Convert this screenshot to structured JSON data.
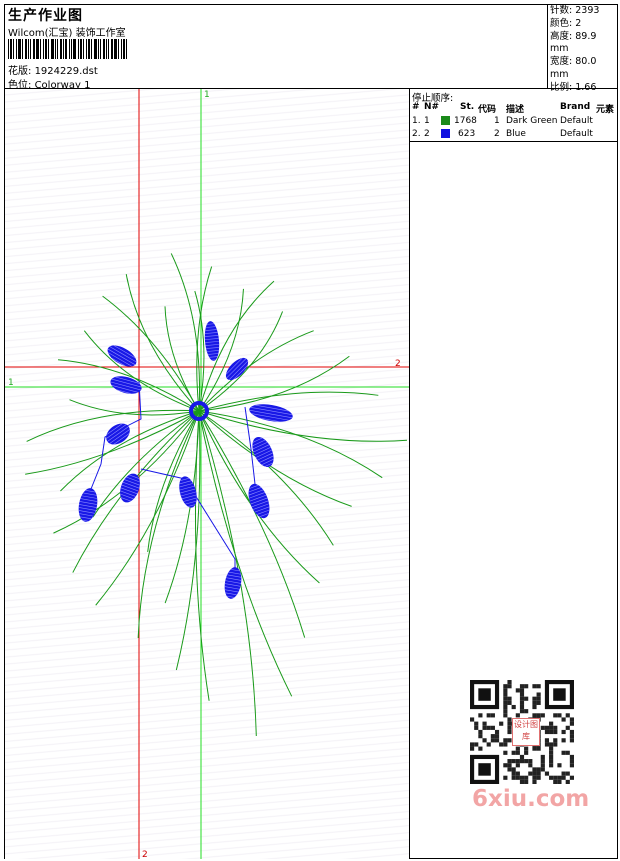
{
  "header": {
    "title": "生产作业图",
    "company": "Wilcom(汇宝) 装饰工作室",
    "pattern_label": "花版:",
    "pattern_value": "1924229.dst",
    "colorway_label": "色位:",
    "colorway_value": "Colorway 1"
  },
  "specs": [
    {
      "label": "针数:",
      "value": "2393"
    },
    {
      "label": "颜色:",
      "value": "2"
    },
    {
      "label": "高度:",
      "value": "89.9 mm"
    },
    {
      "label": "宽度:",
      "value": "80.0 mm"
    },
    {
      "label": "比例:",
      "value": "1.66"
    }
  ],
  "stop_sequence": {
    "label": "停止顺序:",
    "columns": [
      "#",
      "N#",
      "St.",
      "代码",
      "描述",
      "Brand",
      "元素"
    ],
    "rows": [
      {
        "num": "1.",
        "needle": "1",
        "color": "#1a8a1a",
        "stitches": "1768",
        "code": "1",
        "desc": "Dark Green",
        "brand": "Default"
      },
      {
        "num": "2.",
        "needle": "2",
        "color": "#1010e0",
        "stitches": "623",
        "code": "2",
        "desc": "Blue",
        "brand": "Default"
      }
    ]
  },
  "guides": {
    "green_label": "1",
    "red_label": "2"
  },
  "colors": {
    "green": "#1a9a1a",
    "blue": "#1818e6",
    "red_guide": "#e00000",
    "green_guide": "#22dd22"
  },
  "watermark": "6xiu.com",
  "qr_badge": "设计图库"
}
